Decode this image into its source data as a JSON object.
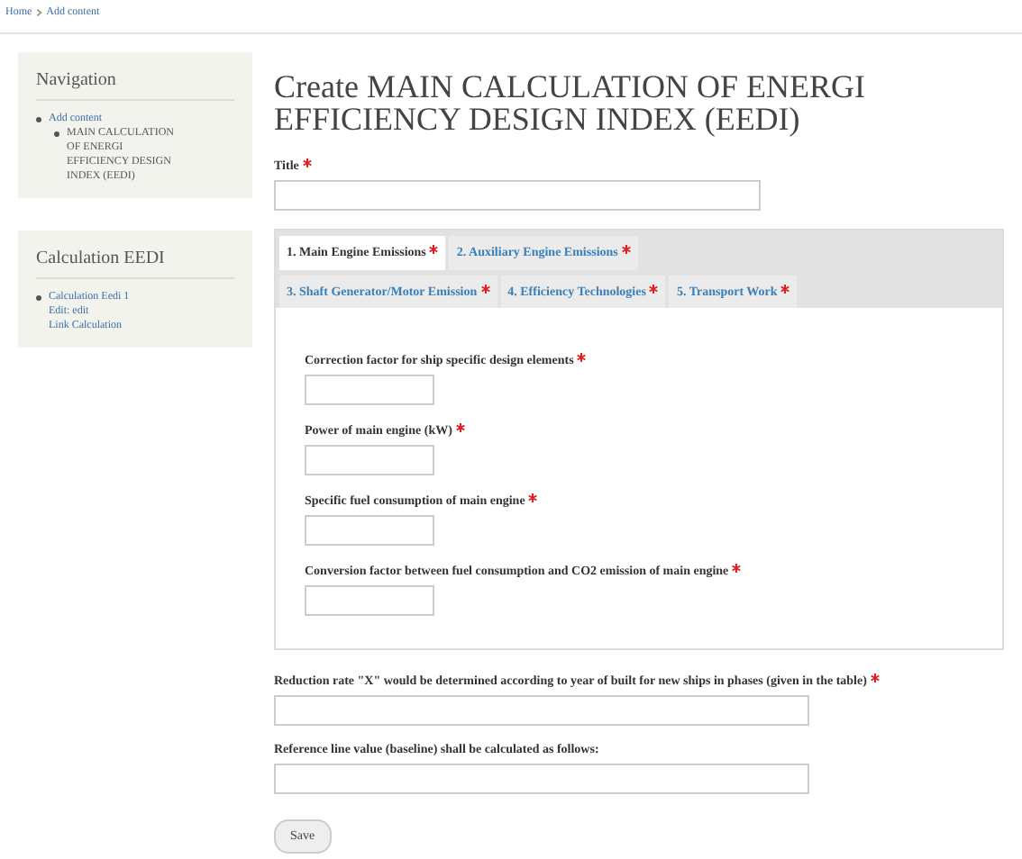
{
  "breadcrumb": [
    "Home",
    "Add content"
  ],
  "sidebar": [
    {
      "title": "Navigation",
      "items": [
        {
          "label": "Add content",
          "children": [
            {
              "label": "MAIN CALCULATION OF ENERGI EFFICIENCY DESIGN INDEX (EEDI)"
            }
          ]
        }
      ]
    },
    {
      "title": "Calculation EEDI",
      "items": [
        {
          "label": "Calculation Eedi 1",
          "lines": [
            "Edit: edit",
            "Link Calculation"
          ]
        }
      ]
    }
  ],
  "page_title": "Create MAIN CALCULATION OF ENERGI EFFICIENCY DESIGN INDEX (EEDI)",
  "title_field": {
    "label": "Title",
    "required": true
  },
  "tabs": [
    [
      {
        "label": "1. Main Engine Emissions",
        "required": true,
        "selected": true
      },
      {
        "label": "2. Auxiliary Engine Emissions",
        "required": true,
        "selected": false
      }
    ],
    [
      {
        "label": "3. Shaft Generator/Motor Emission",
        "required": true,
        "selected": false
      },
      {
        "label": "4. Efficiency Technologies",
        "required": true,
        "selected": false
      },
      {
        "label": "5. Transport Work",
        "required": true,
        "selected": false
      }
    ]
  ],
  "tab_fields": [
    {
      "label": "Correction factor for ship specific design elements",
      "required": true
    },
    {
      "label": "Power of main engine (kW)",
      "required": true
    },
    {
      "label": "Specific fuel consumption of main engine",
      "required": true
    },
    {
      "label": "Conversion factor between fuel consumption and CO2 emission of main engine",
      "required": true
    }
  ],
  "fields": [
    {
      "label": "Reduction rate \"X\" would be determined according to year of built for new ships in phases (given in the table)",
      "required": true
    },
    {
      "label": "Reference line value (baseline) shall be calculated as follows:",
      "required": false
    }
  ],
  "save_button": "Save"
}
